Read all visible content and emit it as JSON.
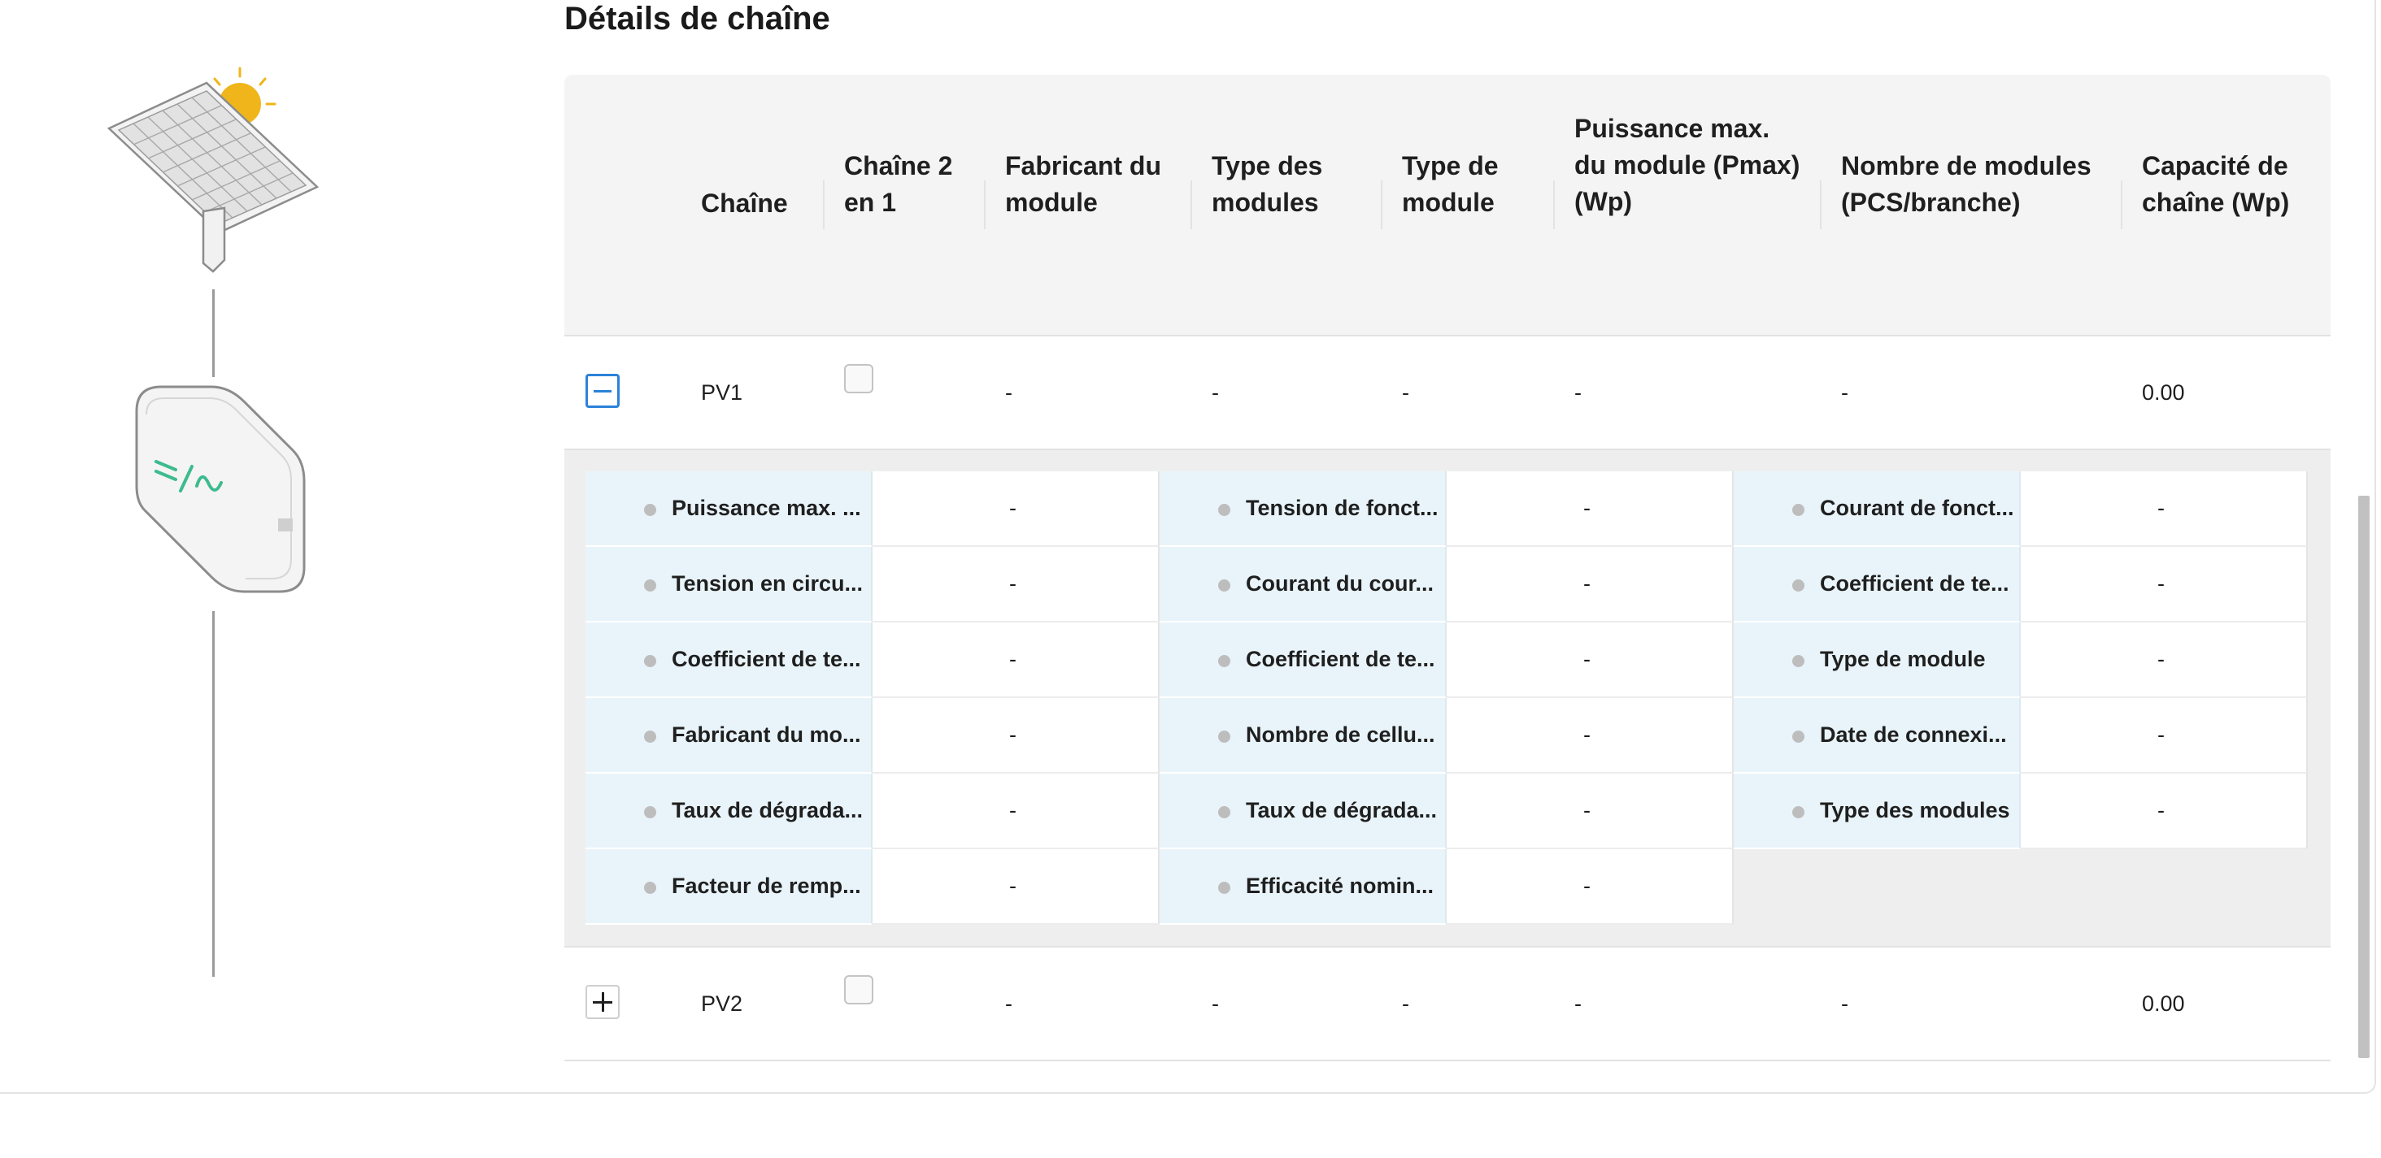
{
  "section_title": "Détails de chaîne",
  "columns": [
    {
      "lines": [
        "Chaîne"
      ]
    },
    {
      "lines": [
        "Chaîne 2",
        "en 1"
      ]
    },
    {
      "lines": [
        "Fabricant du",
        "module"
      ]
    },
    {
      "lines": [
        "Type des",
        "modules"
      ]
    },
    {
      "lines": [
        "Type de",
        "module"
      ]
    },
    {
      "lines": [
        "Puissance max.",
        "du module (Pmax)",
        "(Wp)"
      ]
    },
    {
      "lines": [
        "Nombre de modules",
        "(PCS/branche)"
      ]
    },
    {
      "lines": [
        "Capacité de",
        "chaîne (Wp)"
      ]
    }
  ],
  "rows": [
    {
      "name": "PV1",
      "expanded": true,
      "manufacturer": "-",
      "modules_type": "-",
      "module_type": "-",
      "pmax": "-",
      "modules_count": "-",
      "capacity": "0.00"
    },
    {
      "name": "PV2",
      "expanded": false,
      "manufacturer": "-",
      "modules_type": "-",
      "module_type": "-",
      "pmax": "-",
      "modules_count": "-",
      "capacity": "0.00"
    }
  ],
  "details": [
    {
      "label": "Puissance max. ...",
      "value": "-"
    },
    {
      "label": "Tension de fonct...",
      "value": "-"
    },
    {
      "label": "Courant de fonct...",
      "value": "-"
    },
    {
      "label": "Tension en circu...",
      "value": "-"
    },
    {
      "label": "Courant du cour...",
      "value": "-"
    },
    {
      "label": "Coefficient de te...",
      "value": "-"
    },
    {
      "label": "Coefficient de te...",
      "value": "-"
    },
    {
      "label": "Coefficient de te...",
      "value": "-"
    },
    {
      "label": "Type de module",
      "value": "-"
    },
    {
      "label": "Fabricant du mo...",
      "value": "-"
    },
    {
      "label": "Nombre de cellu...",
      "value": "-"
    },
    {
      "label": "Date de connexi...",
      "value": "-"
    },
    {
      "label": "Taux de dégrada...",
      "value": "-"
    },
    {
      "label": "Taux de dégrada...",
      "value": "-"
    },
    {
      "label": "Type des modules",
      "value": "-"
    },
    {
      "label": "Facteur de remp...",
      "value": "-"
    },
    {
      "label": "Efficacité nomin...",
      "value": "-"
    }
  ],
  "icons": {
    "solar_panel": "solar-panel-icon",
    "inverter": "inverter-icon",
    "sun": "sun-icon"
  },
  "colors": {
    "accent": "#2b82d9",
    "header_bg": "#f4f4f4",
    "detail_label_bg": "#e9f4fa",
    "sun": "#f0b51a",
    "inverter_glyph": "#3dbb8e"
  }
}
